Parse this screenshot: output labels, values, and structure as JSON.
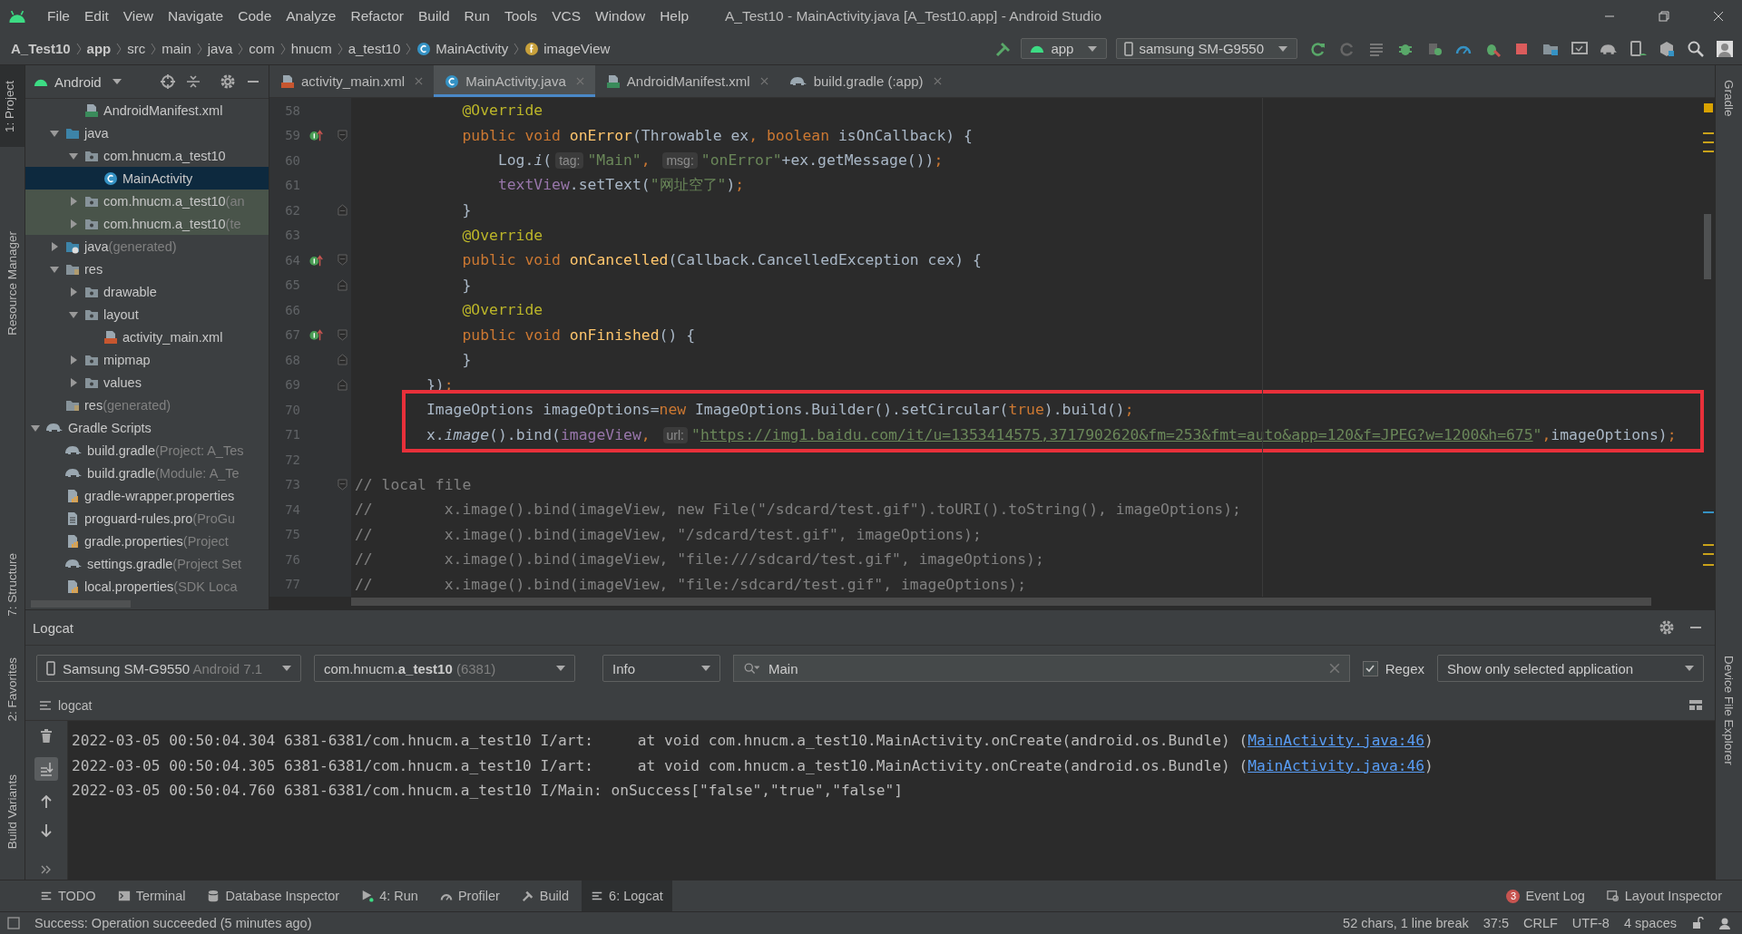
{
  "menu": [
    "File",
    "Edit",
    "View",
    "Navigate",
    "Code",
    "Analyze",
    "Refactor",
    "Build",
    "Run",
    "Tools",
    "VCS",
    "Window",
    "Help"
  ],
  "window": {
    "title": "A_Test10 - MainActivity.java [A_Test10.app] - Android Studio"
  },
  "breadcrumb": [
    {
      "label": "A_Test10",
      "bold": true
    },
    {
      "label": "app",
      "bold": true
    },
    {
      "label": "src",
      "bold": false
    },
    {
      "label": "main",
      "bold": false
    },
    {
      "label": "java",
      "bold": false
    },
    {
      "label": "com",
      "bold": false
    },
    {
      "label": "hnucm",
      "bold": false
    },
    {
      "label": "a_test10",
      "bold": false
    },
    {
      "label": "MainActivity",
      "bold": false,
      "kind": "class"
    },
    {
      "label": "imageView",
      "bold": false,
      "kind": "field"
    }
  ],
  "run_config": "app",
  "device": "samsung SM-G9550",
  "left_strip": [
    {
      "label": "1: Project",
      "selected": true
    },
    {
      "label": "Resource Manager",
      "selected": false
    },
    {
      "label": "7: Structure",
      "selected": false
    },
    {
      "label": "2: Favorites",
      "selected": false
    },
    {
      "label": "Build Variants",
      "selected": false
    }
  ],
  "right_strip": [
    "Gradle",
    "Device File Explorer"
  ],
  "project": {
    "view": "Android",
    "tree": [
      {
        "children": [
          {
            "children": [
              {
                "label": "AndroidManifest.xml",
                "kind": "manifest",
                "selected": false,
                "tinted": false
              }
            ]
          },
          {
            "label": "java",
            "kind": "source",
            "expanded": true,
            "selected": false,
            "tinted": false,
            "children": [
              {
                "label": "com.hnucm.a_test10",
                "kind": "package",
                "expanded": true,
                "selected": false,
                "tinted": false,
                "children": [
                  {
                    "label": "MainActivity",
                    "kind": "class",
                    "selected": true,
                    "tinted": false
                  }
                ]
              },
              {
                "label": "com.hnucm.a_test10",
                "note": "(an",
                "kind": "package",
                "expanded": false,
                "selected": false,
                "tinted": true
              },
              {
                "label": "com.hnucm.a_test10",
                "note": "(te",
                "kind": "package",
                "expanded": false,
                "selected": false,
                "tinted": true
              }
            ]
          },
          {
            "label": "java",
            "note": "(generated)",
            "kind": "generated",
            "expanded": false,
            "selected": false,
            "tinted": false
          },
          {
            "label": "res",
            "kind": "res",
            "expanded": true,
            "selected": false,
            "tinted": false,
            "children": [
              {
                "label": "drawable",
                "kind": "package",
                "expanded": false,
                "selected": false,
                "tinted": false
              },
              {
                "label": "layout",
                "kind": "package",
                "expanded": true,
                "selected": false,
                "tinted": false,
                "children": [
                  {
                    "label": "activity_main.xml",
                    "kind": "xml",
                    "selected": false,
                    "tinted": false
                  }
                ]
              },
              {
                "label": "mipmap",
                "kind": "package",
                "expanded": false,
                "selected": false,
                "tinted": false
              },
              {
                "label": "values",
                "kind": "package",
                "expanded": false,
                "selected": false,
                "tinted": false
              }
            ]
          },
          {
            "label": "res",
            "note": "(generated)",
            "kind": "res",
            "selected": false,
            "tinted": false
          }
        ]
      },
      {
        "label": "Gradle Scripts",
        "kind": "gradle",
        "expanded": true,
        "selected": false,
        "tinted": false,
        "children": [
          {
            "label": "build.gradle",
            "note": "(Project: A_Tes",
            "kind": "gradle",
            "selected": false,
            "tinted": false
          },
          {
            "label": "build.gradle",
            "note": "(Module: A_Te",
            "kind": "gradle",
            "selected": false,
            "tinted": false
          },
          {
            "label": "gradle-wrapper.properties",
            "kind": "properties",
            "selected": false,
            "tinted": false
          },
          {
            "label": "proguard-rules.pro",
            "note": "(ProGu",
            "kind": "text",
            "selected": false,
            "tinted": false
          },
          {
            "label": "gradle.properties",
            "note": "(Project",
            "kind": "properties",
            "selected": false,
            "tinted": false
          },
          {
            "label": "settings.gradle",
            "note": "(Project Set",
            "kind": "gradle",
            "selected": false,
            "tinted": false
          },
          {
            "label": "local.properties",
            "note": "(SDK Loca",
            "kind": "properties",
            "selected": false,
            "tinted": false
          }
        ]
      }
    ]
  },
  "tabs": [
    {
      "label": "activity_main.xml",
      "kind": "xml",
      "selected": false
    },
    {
      "label": "MainActivity.java",
      "kind": "class",
      "selected": true
    },
    {
      "label": "AndroidManifest.xml",
      "kind": "manifest",
      "selected": false
    },
    {
      "label": "build.gradle (:app)",
      "kind": "gradle",
      "selected": false
    }
  ],
  "code": [
    {
      "number": "58",
      "tokens": [
        {
          "text": "            @Override",
          "kind": "annotation"
        }
      ]
    },
    {
      "number": "59",
      "marker": true,
      "fold_start": true,
      "tokens": [
        {
          "text": "            public void ",
          "kind": "keyword"
        },
        {
          "text": "onError",
          "kind": "method"
        },
        {
          "text": "(Throwable ex"
        },
        {
          "text": ", ",
          "kind": "punct"
        },
        {
          "text": "boolean ",
          "kind": "keyword"
        },
        {
          "text": "isOnCallback) {"
        }
      ]
    },
    {
      "number": "60",
      "tokens": [
        {
          "text": "                Log."
        },
        {
          "text": "i",
          "kind": "static"
        },
        {
          "text": "("
        },
        {
          "text": "tag:",
          "kind": "hint"
        },
        {
          "text": "\"Main\"",
          "kind": "string"
        },
        {
          "text": ", ",
          "kind": "punct"
        },
        {
          "text": "msg:",
          "kind": "hint"
        },
        {
          "text": "\"onError\"",
          "kind": "string"
        },
        {
          "text": "+ex.getMessage())"
        },
        {
          "text": ";",
          "kind": "punct"
        }
      ]
    },
    {
      "number": "61",
      "tokens": [
        {
          "text": "                textView",
          "kind": "field"
        },
        {
          "text": ".setText("
        },
        {
          "text": "\"网址空了\"",
          "kind": "string"
        },
        {
          "text": ")"
        },
        {
          "text": ";",
          "kind": "punct"
        }
      ]
    },
    {
      "number": "62",
      "fold_end": true,
      "tokens": [
        {
          "text": "            }"
        }
      ]
    },
    {
      "number": "63",
      "tokens": [
        {
          "text": "            @Override",
          "kind": "annotation"
        }
      ]
    },
    {
      "number": "64",
      "marker": true,
      "fold_start": true,
      "tokens": [
        {
          "text": "            public void ",
          "kind": "keyword"
        },
        {
          "text": "onCancelled",
          "kind": "method"
        },
        {
          "text": "(Callback.CancelledException cex) {"
        }
      ]
    },
    {
      "number": "65",
      "fold_end": true,
      "tokens": [
        {
          "text": "            }"
        }
      ]
    },
    {
      "number": "66",
      "tokens": [
        {
          "text": "            @Override",
          "kind": "annotation"
        }
      ]
    },
    {
      "number": "67",
      "marker": true,
      "fold_start": true,
      "tokens": [
        {
          "text": "            public void ",
          "kind": "keyword"
        },
        {
          "text": "onFinished",
          "kind": "method"
        },
        {
          "text": "() {"
        }
      ]
    },
    {
      "number": "68",
      "fold_end": true,
      "tokens": [
        {
          "text": "            }"
        }
      ]
    },
    {
      "number": "69",
      "fold_end": true,
      "tokens": [
        {
          "text": "        })"
        },
        {
          "text": ";",
          "kind": "punct"
        }
      ]
    },
    {
      "number": "70",
      "highlighted": true,
      "tokens": [
        {
          "text": "        ImageOptions imageOptions="
        },
        {
          "text": "new",
          "kind": "keyword"
        },
        {
          "text": " ImageOptions.Builder().setCircular("
        },
        {
          "text": "true",
          "kind": "keyword"
        },
        {
          "text": ").build()"
        },
        {
          "text": ";",
          "kind": "punct"
        }
      ]
    },
    {
      "number": "71",
      "highlighted": true,
      "tokens": [
        {
          "text": "        x."
        },
        {
          "text": "image",
          "kind": "static"
        },
        {
          "text": "().bind("
        },
        {
          "text": "imageView",
          "kind": "field"
        },
        {
          "text": ", ",
          "kind": "punct"
        },
        {
          "text": "url:",
          "kind": "hint"
        },
        {
          "text": "\"",
          "kind": "string"
        },
        {
          "text": "https://img1.baidu.com/it/u=1353414575,3717902620&fm=253&fmt=auto&app=120&f=JPEG?w=1200&h=675",
          "kind": "link"
        },
        {
          "text": "\"",
          "kind": "string"
        },
        {
          "text": ",",
          "kind": "punct"
        },
        {
          "text": "imageOptions)"
        },
        {
          "text": ";",
          "kind": "punct"
        }
      ]
    },
    {
      "number": "72"
    },
    {
      "number": "73",
      "fold_start": true,
      "tokens": [
        {
          "text": "// local file",
          "kind": "comment"
        }
      ]
    },
    {
      "number": "74",
      "tokens": [
        {
          "text": "//        x.image().bind(imageView, new File(\"/sdcard/test.gif\").toURI().toString(), imageOptions);",
          "kind": "comment"
        }
      ]
    },
    {
      "number": "75",
      "tokens": [
        {
          "text": "//        x.image().bind(imageView, \"/sdcard/test.gif\", imageOptions);",
          "kind": "comment"
        }
      ]
    },
    {
      "number": "76",
      "tokens": [
        {
          "text": "//        x.image().bind(imageView, \"file:///sdcard/test.gif\", imageOptions);",
          "kind": "comment"
        }
      ]
    },
    {
      "number": "77",
      "tokens": [
        {
          "text": "//        x.image().bind(imageView, \"file:/sdcard/test.gif\", imageOptions);",
          "kind": "comment"
        }
      ]
    }
  ],
  "logcat": {
    "title": "Logcat",
    "device": {
      "name": "Samsung SM-G9550",
      "note": "Android 7.1"
    },
    "process": {
      "name": "com.hnucm.**a_test10**",
      "note": "(6381)"
    },
    "level": "Info",
    "search": {
      "value": "Main"
    },
    "regex": {
      "label": "Regex",
      "checked": true
    },
    "filter": "Show only selected application",
    "panel_label": "logcat",
    "lines": [
      {
        "text": "2022-03-05 00:50:04.304 6381-6381/com.hnucm.a_test10 I/art:     at void com.hnucm.a_test10.MainActivity.onCreate(android.os.Bundle) (",
        "link": "MainActivity.java:46",
        "after": ")"
      },
      {
        "text": "2022-03-05 00:50:04.305 6381-6381/com.hnucm.a_test10 I/art:     at void com.hnucm.a_test10.MainActivity.onCreate(android.os.Bundle) (",
        "link": "MainActivity.java:46",
        "after": ")"
      },
      {
        "text": "2022-03-05 00:50:04.760 6381-6381/com.hnucm.a_test10 I/Main: onSuccess[\"false\",\"true\",\"false\"]"
      }
    ]
  },
  "tool_tabs": [
    {
      "label": "TODO",
      "kind": "list",
      "selected": false
    },
    {
      "label": "Terminal",
      "kind": "terminal",
      "selected": false
    },
    {
      "label": "Database Inspector",
      "kind": "database",
      "selected": false
    },
    {
      "label": "4: Run",
      "kind": "run",
      "selected": false
    },
    {
      "label": "Profiler",
      "kind": "gauge",
      "selected": false
    },
    {
      "label": "Build",
      "kind": "hammer",
      "selected": false
    },
    {
      "label": "6: Logcat",
      "kind": "list",
      "selected": true
    }
  ],
  "event_log": {
    "label": "Event Log",
    "count": "3"
  },
  "layout_inspector": "Layout Inspector",
  "status_bar": {
    "message": "Success: Operation succeeded (5 minutes ago)",
    "items": [
      "52 chars, 1 line break",
      "37:5",
      "CRLF",
      "UTF-8",
      "4 spaces"
    ]
  }
}
